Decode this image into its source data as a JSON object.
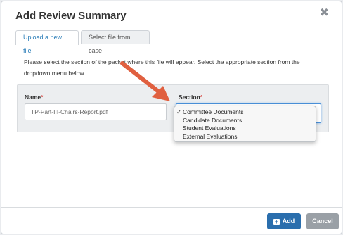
{
  "modal": {
    "title": "Add Review Summary",
    "close_glyph": "✖"
  },
  "tabs": [
    {
      "label": "Upload a new file",
      "active": true
    },
    {
      "label": "Select file from case",
      "active": false
    }
  ],
  "instructions": "Please select the section of the packet where this file will appear. Select the appropriate section from the dropdown menu below.",
  "form": {
    "name_label": "Name",
    "section_label": "Section",
    "required_mark": "*",
    "name_value": "TP-Part-III-Chairs-Report.pdf"
  },
  "dropdown": {
    "check": "✓",
    "options": [
      "Committee Documents",
      "Candidate Documents",
      "Student Evaluations",
      "External Evaluations"
    ],
    "selected_index": 0
  },
  "footer": {
    "add_label": "Add",
    "add_icon": "plus-square-icon",
    "cancel_label": "Cancel"
  },
  "colors": {
    "accent": "#2a6ead",
    "arrow": "#e06040",
    "required": "#d9534f"
  }
}
